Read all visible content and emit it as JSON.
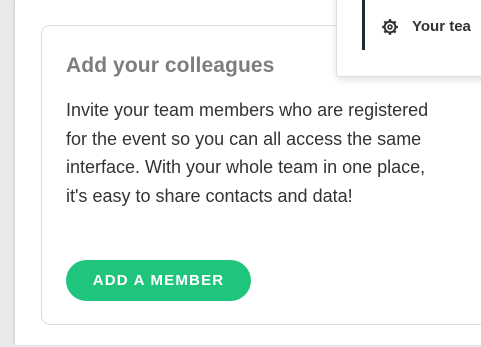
{
  "card": {
    "title": "Add your colleagues",
    "body": "Invite your team members who are registered for the event so you can all access the same interface. With your whole team in one place, it's easy to share contacts and data!",
    "button_label": "ADD A MEMBER"
  },
  "dropdown": {
    "item_label": "Your tea",
    "item_icon": "gear-icon"
  },
  "colors": {
    "accent": "#1fc57d",
    "title": "#7d7d7d",
    "text": "#333333"
  }
}
